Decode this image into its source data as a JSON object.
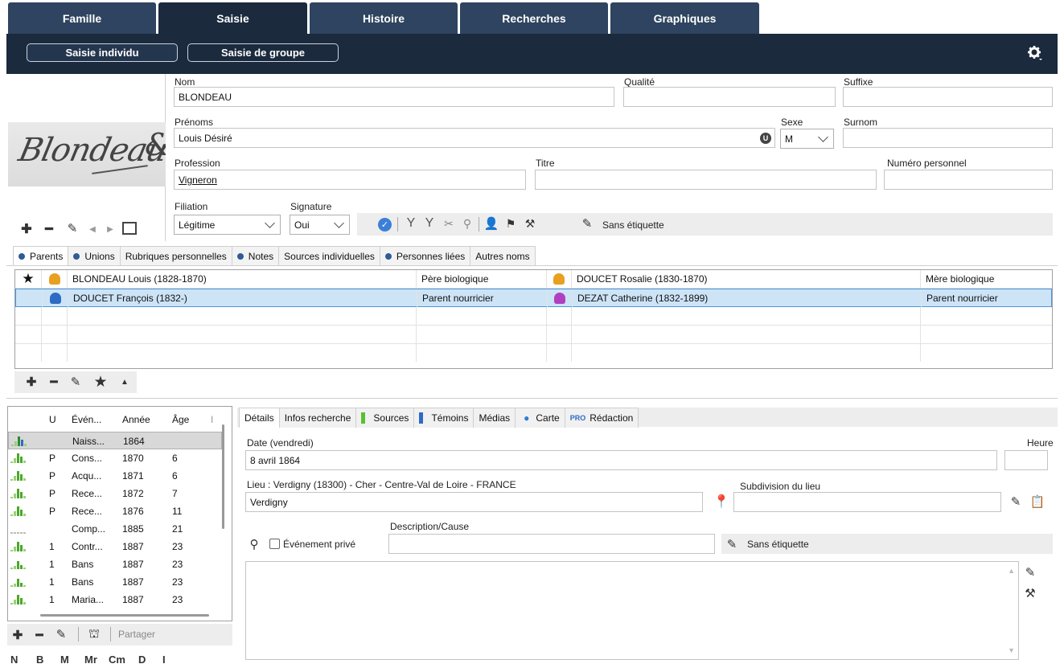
{
  "top_tabs": [
    "Famille",
    "Saisie",
    "Histoire",
    "Recherches",
    "Graphiques"
  ],
  "sub_buttons": [
    "Saisie individu",
    "Saisie de groupe"
  ],
  "form": {
    "nom_label": "Nom",
    "nom_value": "BLONDEAU",
    "qualite_label": "Qualité",
    "qualite_value": "",
    "suffixe_label": "Suffixe",
    "suffixe_value": "",
    "prenoms_label": "Prénoms",
    "prenoms_value": "Louis Désiré",
    "sexe_label": "Sexe",
    "sexe_value": "M",
    "surnom_label": "Surnom",
    "surnom_value": "",
    "profession_label": "Profession",
    "profession_value": "Vigneron",
    "titre_label": "Titre",
    "titre_value": "",
    "numero_label": "Numéro personnel",
    "numero_value": "",
    "filiation_label": "Filiation",
    "filiation_value": "Légitime",
    "signature_label": "Signature",
    "signature_value": "Oui",
    "tag_label": "Sans étiquette",
    "u_badge": "U"
  },
  "signature_image_text": "Blondeau",
  "subtabs": [
    {
      "label": "Parents",
      "dot": true
    },
    {
      "label": "Unions",
      "dot": true
    },
    {
      "label": "Rubriques personnelles",
      "dot": false
    },
    {
      "label": "Notes",
      "dot": true
    },
    {
      "label": "Sources individuelles",
      "dot": false
    },
    {
      "label": "Personnes liées",
      "dot": true
    },
    {
      "label": "Autres noms",
      "dot": false
    }
  ],
  "parents": [
    {
      "father": "BLONDEAU Louis (1828-1870)",
      "father_rel": "Père biologique",
      "mother": "DOUCET Rosalie (1830-1870)",
      "mother_rel": "Mère biologique",
      "father_color": "#e8a020",
      "mother_color": "#e8a020"
    },
    {
      "father": "DOUCET François (1832-)",
      "father_rel": "Parent nourricier",
      "mother": "DEZAT Catherine (1832-1899)",
      "mother_rel": "Parent nourricier",
      "father_color": "#2e6bc4",
      "mother_color": "#b040c0"
    }
  ],
  "events_header": [
    "U",
    "Évén...",
    "Année",
    "Âge"
  ],
  "events": [
    {
      "u": "",
      "name": "Naiss...",
      "year": "1864",
      "age": ""
    },
    {
      "u": "P",
      "name": "Cons...",
      "year": "1870",
      "age": "6"
    },
    {
      "u": "P",
      "name": "Acqu...",
      "year": "1871",
      "age": "6"
    },
    {
      "u": "P",
      "name": "Rece...",
      "year": "1872",
      "age": "7"
    },
    {
      "u": "P",
      "name": "Rece...",
      "year": "1876",
      "age": "11"
    },
    {
      "u": "",
      "name": "Comp...",
      "year": "1885",
      "age": "21"
    },
    {
      "u": "1",
      "name": "Contr...",
      "year": "1887",
      "age": "23"
    },
    {
      "u": "1",
      "name": "Bans",
      "year": "1887",
      "age": "23"
    },
    {
      "u": "1",
      "name": "Bans",
      "year": "1887",
      "age": "23"
    },
    {
      "u": "1",
      "name": "Maria...",
      "year": "1887",
      "age": "23"
    }
  ],
  "events_share": "Partager",
  "bottom_letters": [
    "N",
    "B",
    "M",
    "Mr",
    "Cm",
    "D",
    "I"
  ],
  "detail_tabs": [
    {
      "label": "Détails"
    },
    {
      "label": "Infos recherche"
    },
    {
      "label": "Sources"
    },
    {
      "label": "Témoins"
    },
    {
      "label": "Médias"
    },
    {
      "label": "Carte"
    },
    {
      "label": "Rédaction",
      "pro": "PRO"
    }
  ],
  "detail": {
    "date_label": "Date (vendredi)",
    "date_value": "8 avril 1864",
    "heure_label": "Heure",
    "heure_value": "",
    "lieu_label": "Lieu : Verdigny (18300) - Cher - Centre-Val de Loire - FRANCE",
    "lieu_value": "Verdigny",
    "subdivision_label": "Subdivision du lieu",
    "subdivision_value": "",
    "prive_label": "Événement privé",
    "description_label": "Description/Cause",
    "description_value": "",
    "tag_label": "Sans étiquette"
  }
}
